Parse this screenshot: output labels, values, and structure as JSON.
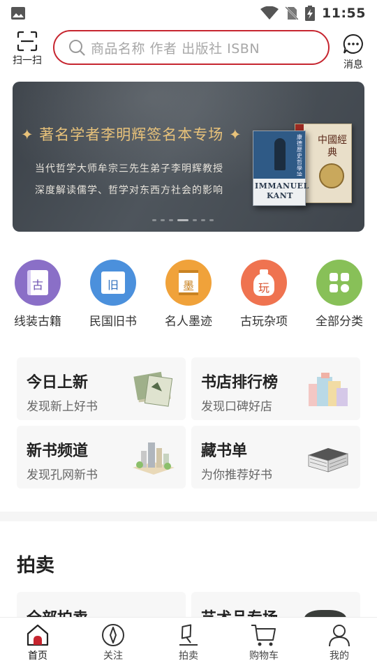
{
  "status_bar": {
    "time": "11:55"
  },
  "header": {
    "scan_label": "扫一扫",
    "search_placeholder": "商品名称 作者 出版社 ISBN",
    "messages_label": "消息"
  },
  "banner": {
    "title": "✦ 著名学者李明辉签名本专场 ✦",
    "line1": "当代哲学大师牟宗三先生弟子李明辉教授",
    "line2": "深度解读儒学、哲学对东西方社会的影响",
    "book1_title": "IMMANUEL KANT",
    "book1_spine": "康德歷史哲學論文集",
    "book2_title": "中國經典",
    "slide_count": 7,
    "active_slide": 3
  },
  "categories": [
    {
      "label": "线装古籍",
      "glyph": "古",
      "icon": "thread-bound-book-icon",
      "color": "#8a6fc7"
    },
    {
      "label": "民国旧书",
      "glyph": "旧",
      "icon": "old-book-icon",
      "color": "#4b90dc"
    },
    {
      "label": "名人墨迹",
      "glyph": "墨",
      "icon": "calligraphy-scroll-icon",
      "color": "#f0a23a"
    },
    {
      "label": "古玩杂项",
      "glyph": "玩",
      "icon": "antique-vase-icon",
      "color": "#ef7350"
    },
    {
      "label": "全部分类",
      "glyph": "",
      "icon": "all-categories-grid-icon",
      "color": "#88c058"
    }
  ],
  "entries": [
    {
      "title": "今日上新",
      "subtitle": "发现新上好书",
      "icon": "new-books-stack-icon"
    },
    {
      "title": "书店排行榜",
      "subtitle": "发现口碑好店",
      "icon": "ranking-books-icon"
    },
    {
      "title": "新书频道",
      "subtitle": "发现孔网新书",
      "icon": "popup-city-book-icon"
    },
    {
      "title": "藏书单",
      "subtitle": "为你推荐好书",
      "icon": "book-pile-icon"
    }
  ],
  "auction": {
    "section_title": "拍卖",
    "cards": [
      {
        "title": "全部拍卖"
      },
      {
        "title": "艺术品专场"
      }
    ]
  },
  "tabbar": {
    "tabs": [
      {
        "label": "首页",
        "icon": "home-icon",
        "active": true
      },
      {
        "label": "关注",
        "icon": "compass-follow-icon",
        "active": false
      },
      {
        "label": "拍卖",
        "icon": "auction-gavel-icon",
        "active": false
      },
      {
        "label": "购物车",
        "icon": "shopping-cart-icon",
        "active": false
      },
      {
        "label": "我的",
        "icon": "user-profile-icon",
        "active": false
      }
    ],
    "accent_color": "#c6252f"
  }
}
